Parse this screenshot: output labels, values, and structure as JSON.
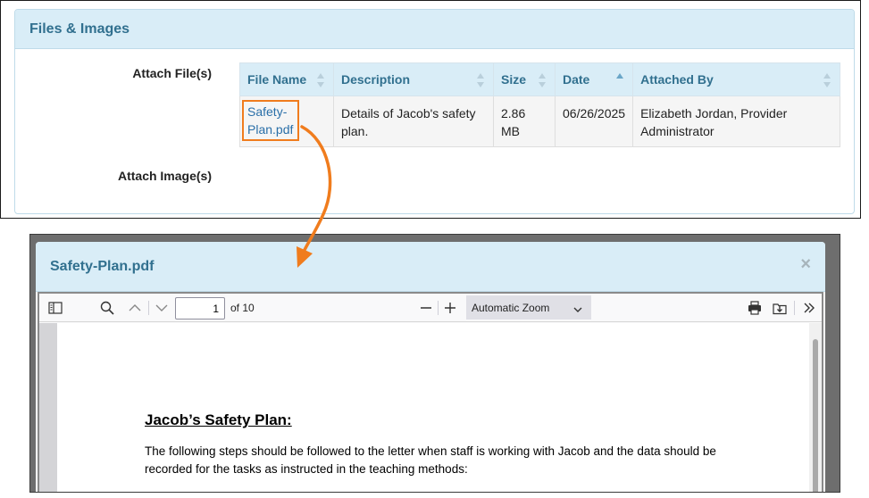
{
  "panel": {
    "title": "Files & Images",
    "attach_files_label": "Attach File(s)",
    "attach_images_label": "Attach Image(s)"
  },
  "files_table": {
    "columns": [
      "File Name",
      "Description",
      "Size",
      "Date",
      "Attached By"
    ],
    "sort_column": "Date",
    "sort_direction": "ascending",
    "rows": [
      {
        "file_name": "Safety-Plan.pdf",
        "description": "Details of Jacob's safety plan.",
        "size": "2.86 MB",
        "date": "06/26/2025",
        "attached_by": "Elizabeth Jordan, Provider Administrator"
      }
    ]
  },
  "modal": {
    "title": "Safety-Plan.pdf",
    "close_glyph": "×"
  },
  "viewer": {
    "current_page": "1",
    "page_total": "of 10",
    "zoom": "Automatic Zoom"
  },
  "pdf": {
    "title": "Jacob’s Safety Plan:",
    "body": "The following steps should be followed to the letter when staff is working with Jacob and the data should be recorded for the tasks as instructed in the teaching methods:"
  },
  "icons": {
    "sidebar_toggle": "sidebar-toggle-icon",
    "search": "search-icon",
    "prev": "chevron-up-icon",
    "next": "chevron-down-icon",
    "zoom_out": "minus-icon",
    "zoom_in": "plus-icon",
    "print": "printer-icon",
    "download": "download-icon",
    "more": "double-chevron-right-icon"
  },
  "colors": {
    "accent": "#31708f",
    "header_bg": "#d9edf7",
    "highlight": "#f07c1d",
    "link": "#2a6fa8"
  }
}
